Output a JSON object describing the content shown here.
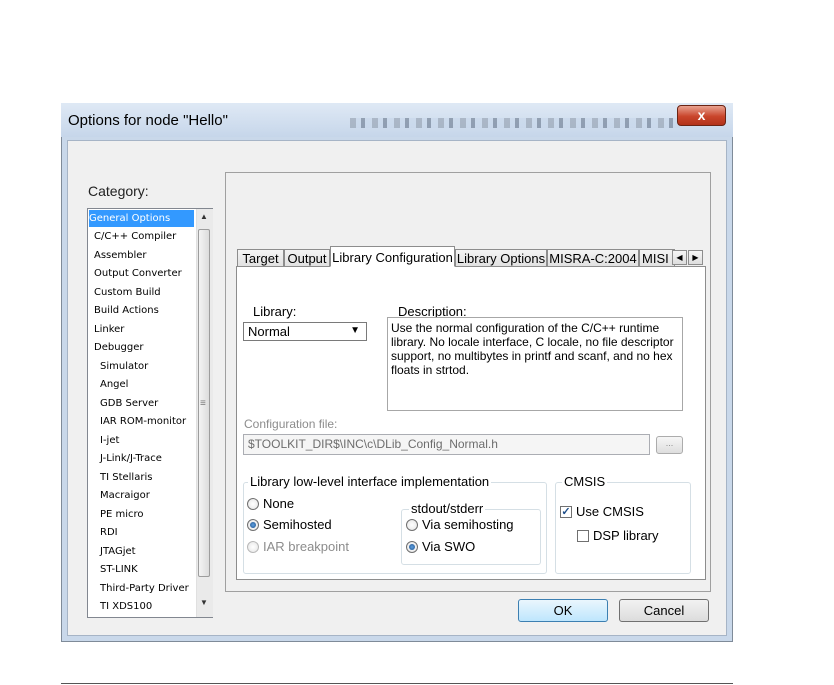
{
  "window": {
    "title": "Options for node \"Hello\"",
    "close_label": "x"
  },
  "category": {
    "label": "Category:",
    "items": [
      "General Options",
      "C/C++ Compiler",
      "Assembler",
      "Output Converter",
      "Custom Build",
      "Build Actions",
      "Linker",
      "Debugger",
      "Simulator",
      "Angel",
      "GDB Server",
      "IAR ROM-monitor",
      "I-jet",
      "J-Link/J-Trace",
      "TI Stellaris",
      "Macraigor",
      "PE micro",
      "RDI",
      "JTAGjet",
      "ST-LINK",
      "Third-Party Driver",
      "TI XDS100"
    ],
    "selected": "General Options"
  },
  "tabs": [
    "Target",
    "Output",
    "Library Configuration",
    "Library Options",
    "MISRA-C:2004",
    "MISI"
  ],
  "active_tab": "Library Configuration",
  "library": {
    "label": "Library:",
    "value": "Normal",
    "description_label": "Description:",
    "description": "Use the normal configuration of the C/C++ runtime library. No locale interface, C locale, no file descriptor support, no multibytes in printf and scanf, and no hex floats in strtod."
  },
  "config_file": {
    "label": "Configuration file:",
    "value": "$TOOLKIT_DIR$\\INC\\c\\DLib_Config_Normal.h",
    "browse_label": "..."
  },
  "lowlevel": {
    "label": "Library low-level interface implementation",
    "options": [
      "None",
      "Semihosted",
      "IAR breakpoint"
    ],
    "selected": "Semihosted",
    "stdout": {
      "label": "stdout/stderr",
      "options": [
        "Via semihosting",
        "Via SWO"
      ],
      "selected": "Via SWO"
    }
  },
  "cmsis": {
    "label": "CMSIS",
    "use_cmsis_label": "Use CMSIS",
    "use_cmsis_checked": true,
    "dsp_label": "DSP library",
    "dsp_checked": false
  },
  "buttons": {
    "ok": "OK",
    "cancel": "Cancel"
  },
  "icons": [
    "close-icon",
    "scroll-up-icon",
    "scroll-down-icon",
    "tab-scroll-left-icon",
    "tab-scroll-right-icon",
    "dropdown-arrow-icon"
  ]
}
